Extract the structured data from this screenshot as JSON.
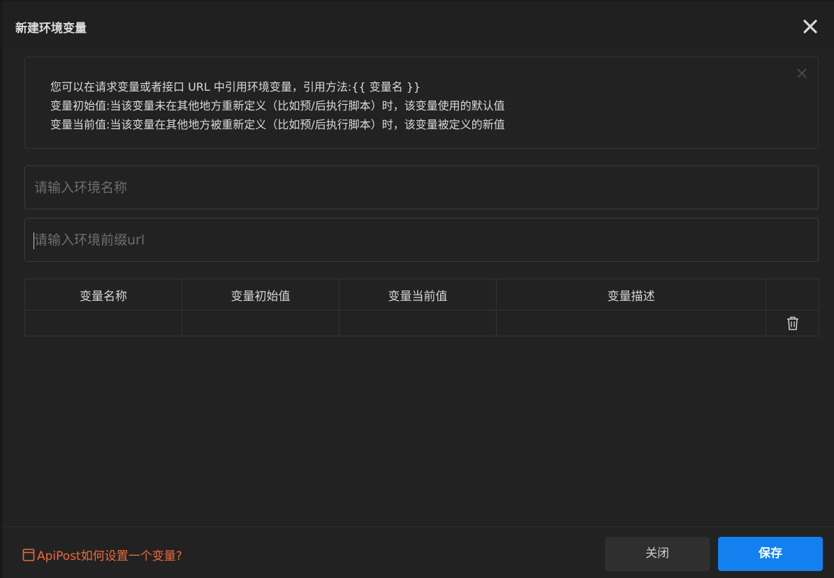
{
  "dialog": {
    "title": "新建环境变量"
  },
  "notice": {
    "lines": [
      "您可以在请求变量或者接口 URL 中引用环境变量，引用方法:{{ 变量名 }}",
      "变量初始值:当该变量未在其他地方重新定义（比如预/后执行脚本）时，该变量使用的默认值",
      "变量当前值:当该变量在其他地方被重新定义（比如预/后执行脚本）时，该变量被定义的新值"
    ]
  },
  "form": {
    "env_name_placeholder": "请输入环境名称",
    "env_name_value": "",
    "env_url_placeholder": "请输入环境前缀url",
    "env_url_value": ""
  },
  "table": {
    "columns": [
      "变量名称",
      "变量初始值",
      "变量当前值",
      "变量描述",
      ""
    ],
    "rows": [
      {
        "name": "",
        "initial": "",
        "current": "",
        "description": ""
      }
    ]
  },
  "footer": {
    "help_link": "ApiPost如何设置一个变量?",
    "close_label": "关闭",
    "save_label": "保存"
  },
  "colors": {
    "accent": "#1380f0",
    "link": "#ee6a3a",
    "background": "#222222"
  },
  "icons": {
    "close": "close-icon",
    "notice_close": "close-icon",
    "delete": "trash-icon",
    "help": "document-icon"
  }
}
